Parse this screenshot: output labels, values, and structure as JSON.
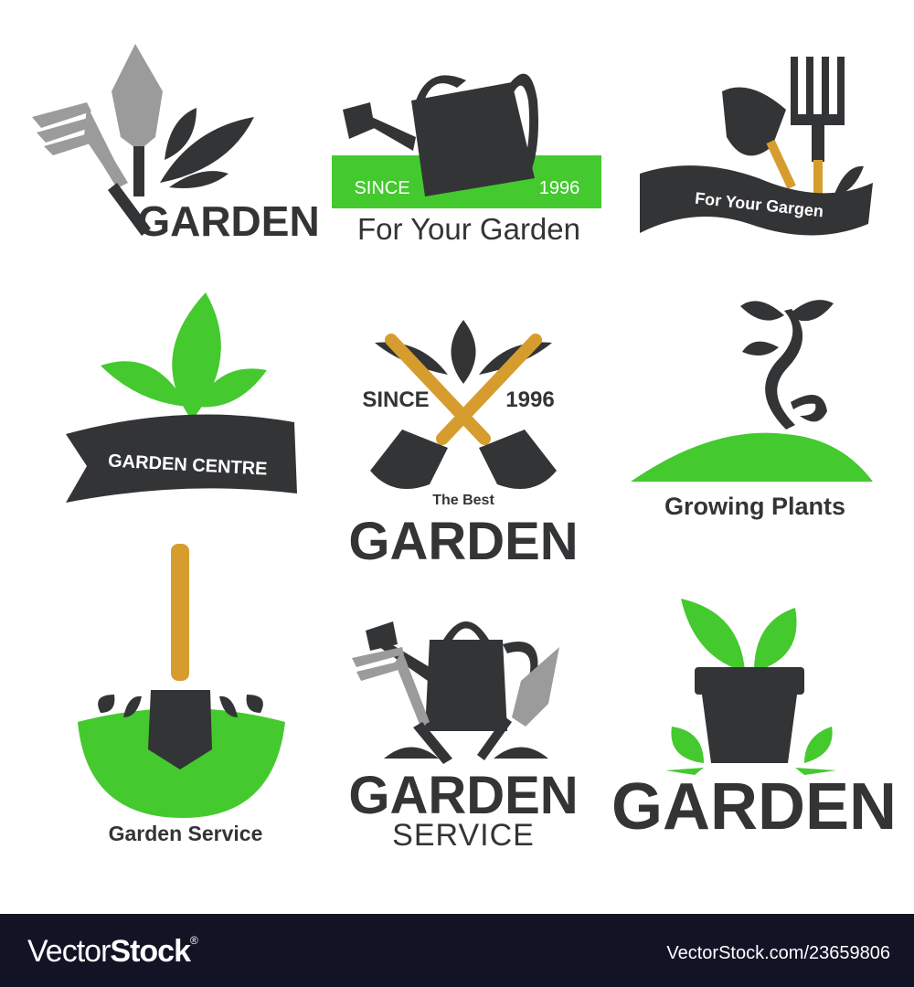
{
  "colors": {
    "dark": "#333436",
    "green": "#44c92e",
    "grey": "#9b9b9b",
    "handle": "#d69d2e",
    "footer": "#121426"
  },
  "logos": {
    "l1": {
      "title": "GARDEN"
    },
    "l2": {
      "since": "SINCE",
      "year": "1996",
      "title": "For Your Garden"
    },
    "l3": {
      "title": "For Your Gargen"
    },
    "l4": {
      "title": "GARDEN CENTRE"
    },
    "l5": {
      "since": "SINCE",
      "year": "1996",
      "subtitle": "The Best",
      "title": "GARDEN"
    },
    "l6": {
      "title": "Growing Plants"
    },
    "l7": {
      "title": "Garden Service"
    },
    "l8": {
      "title": "GARDEN",
      "subtitle": "SERVICE"
    },
    "l9": {
      "title": "GARDEN"
    }
  },
  "footer": {
    "brand_light": "Vector",
    "brand_bold": "Stock",
    "registered": "®",
    "url": "VectorStock.com/23659806"
  }
}
